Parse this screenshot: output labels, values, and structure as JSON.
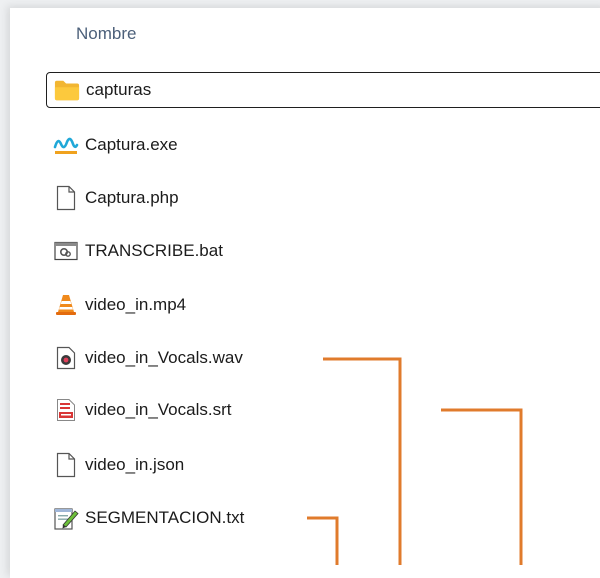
{
  "header": {
    "column_name": "Nombre"
  },
  "files": [
    {
      "name": "capturas",
      "icon": "folder-icon",
      "selected": true
    },
    {
      "name": "Captura.exe",
      "icon": "exe-wave-icon"
    },
    {
      "name": "Captura.php",
      "icon": "blank-file-icon"
    },
    {
      "name": "TRANSCRIBE.bat",
      "icon": "batch-file-icon"
    },
    {
      "name": "video_in.mp4",
      "icon": "vlc-cone-icon"
    },
    {
      "name": "video_in_Vocals.wav",
      "icon": "audio-file-icon"
    },
    {
      "name": "video_in_Vocals.srt",
      "icon": "subtitle-file-icon"
    },
    {
      "name": "video_in.json",
      "icon": "blank-file-icon"
    },
    {
      "name": "SEGMENTACION.txt",
      "icon": "notepad-icon"
    }
  ],
  "colors": {
    "connector": "#e07b2c",
    "selection_border": "#1f1f1f"
  }
}
